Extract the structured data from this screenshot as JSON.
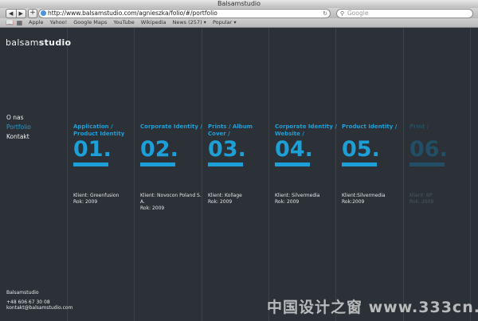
{
  "window": {
    "title": "Balsamstudio"
  },
  "toolbar": {
    "back_label": "◀",
    "forward_label": "▶",
    "add_label": "+",
    "url": "http://www.balsamstudio.com/agnieszka/folio/#/portfolio",
    "reload_label": "↻",
    "search_placeholder": "Google",
    "search_icon": "magnifier-icon"
  },
  "bookmarks": {
    "items": [
      "Apple",
      "Yahoo!",
      "Google Maps",
      "YouTube",
      "Wikipedia",
      "News (257) ▾",
      "Popular ▾"
    ]
  },
  "site": {
    "logo_light": "balsam",
    "logo_bold": "studio",
    "nav": [
      {
        "label": "O nas",
        "active": false
      },
      {
        "label": "Portfolio",
        "active": true
      },
      {
        "label": "Kontakt",
        "active": false
      }
    ],
    "footer": {
      "name": "Balsamstudio",
      "phone": "+48 606 67 30 08",
      "email": "kontakt@balsamstudio.com"
    }
  },
  "projects": [
    {
      "category": "Application / Product Identity",
      "number": "01.",
      "client": "Klient: Greenfusion",
      "year": "Rok: 2009"
    },
    {
      "category": "Corporate Identity /",
      "number": "02.",
      "client": "Klient: Novocon Poland S. A.",
      "year": "Rok: 2009"
    },
    {
      "category": "Prints /  Album Cover /",
      "number": "03.",
      "client": "Klient: Kollage",
      "year": "Rok: 2009"
    },
    {
      "category": "Corporate Identity / Website /",
      "number": "04.",
      "client": "Klient: Silvermedia",
      "year": "Rok: 2009"
    },
    {
      "category": "Product Identity /",
      "number": "05.",
      "client": "Klient:Silvermedia",
      "year": "Rok:2009"
    },
    {
      "category": "Print /",
      "number": "06.",
      "client": "Klient: BP",
      "year": "Rok: 2009"
    }
  ],
  "watermark": "中国设计之窗 www.333cn.com",
  "colors": {
    "accent": "#1d9fd8",
    "background": "#2b3137"
  }
}
